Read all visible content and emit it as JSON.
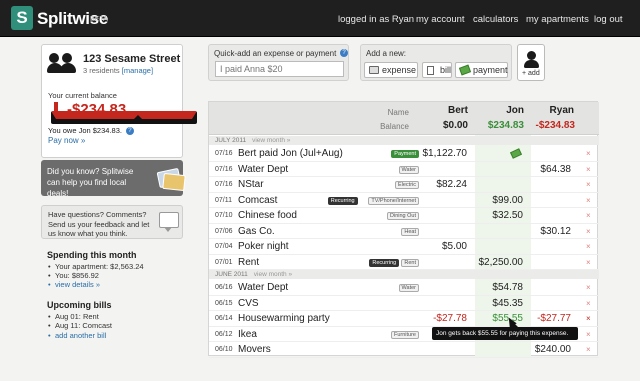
{
  "app": {
    "name": "Splitwise",
    "beta": "BETA",
    "logo_letter": "S"
  },
  "nav": [
    "logged in as Ryan",
    "my account",
    "calculators",
    "my apartments",
    "log out"
  ],
  "sidebar": {
    "address": "123 Sesame Street",
    "residents": "3 residents",
    "manage": "[manage]",
    "balance_label": "Your current balance",
    "balance": "-$234.83",
    "owe": "You owe Jon $234.83.",
    "pay_now": "Pay now »",
    "did_you_know": "Did you know? Splitwise can help you find local deals!",
    "questions": "Have questions? Comments? Send us your feedback and let us know what you think.",
    "spending_title": "Spending this month",
    "spending": [
      "Your apartment: $2,563.24",
      "You: $856.92"
    ],
    "view_details": "view details »",
    "bills_title": "Upcoming bills",
    "bills": [
      "Aug 01: Rent",
      "Aug 11: Comcast"
    ],
    "add_bill": "add another bill"
  },
  "quick_add": {
    "label": "Quick-add an expense or payment",
    "placeholder": "I paid Anna $20",
    "help": "?"
  },
  "add_new": {
    "label": "Add a new:",
    "buttons": [
      "expense",
      "bill",
      "payment"
    ]
  },
  "add_person": {
    "label": "+ add"
  },
  "table": {
    "name_label": "Name",
    "balance_label": "Balance",
    "people": [
      {
        "name": "Bert",
        "balance": "$0.00"
      },
      {
        "name": "Jon",
        "balance": "$234.83"
      },
      {
        "name": "Ryan",
        "balance": "-$234.83"
      }
    ],
    "months": [
      {
        "label": "JULY 2011",
        "view": "view month »",
        "rows": [
          {
            "date": "07/16",
            "desc": "Bert paid Jon (Jul+Aug)",
            "tags": [
              "Payment"
            ],
            "bert": "$1,122.70",
            "jon": "",
            "ryan": ""
          },
          {
            "date": "07/16",
            "desc": "Water Dept",
            "tags": [
              "Water"
            ],
            "bert": "",
            "jon": "",
            "ryan": "$64.38"
          },
          {
            "date": "07/16",
            "desc": "NStar",
            "tags": [
              "Electric"
            ],
            "bert": "$82.24",
            "jon": "",
            "ryan": ""
          },
          {
            "date": "07/11",
            "desc": "Comcast",
            "tags": [
              "Recurring",
              "TV/Phone/Internet"
            ],
            "bert": "",
            "jon": "$99.00",
            "ryan": ""
          },
          {
            "date": "07/10",
            "desc": "Chinese food",
            "tags": [
              "Dining Out"
            ],
            "bert": "",
            "jon": "$32.50",
            "ryan": ""
          },
          {
            "date": "07/06",
            "desc": "Gas Co.",
            "tags": [
              "Heat"
            ],
            "bert": "",
            "jon": "",
            "ryan": "$30.12"
          },
          {
            "date": "07/04",
            "desc": "Poker night",
            "tags": [],
            "bert": "$5.00",
            "jon": "",
            "ryan": ""
          },
          {
            "date": "07/01",
            "desc": "Rent",
            "tags": [
              "Recurring",
              "Rent"
            ],
            "bert": "",
            "jon": "$2,250.00",
            "ryan": ""
          }
        ]
      },
      {
        "label": "JUNE 2011",
        "view": "view month »",
        "rows": [
          {
            "date": "06/16",
            "desc": "Water Dept",
            "tags": [
              "Water"
            ],
            "bert": "",
            "jon": "$54.78",
            "ryan": ""
          },
          {
            "date": "06/15",
            "desc": "CVS",
            "tags": [],
            "bert": "",
            "jon": "$45.35",
            "ryan": ""
          },
          {
            "date": "06/14",
            "desc": "Housewarming party",
            "tags": [],
            "bert": "-$27.78",
            "jon": "$55.55",
            "ryan": "-$27.77"
          },
          {
            "date": "06/12",
            "desc": "Ikea",
            "tags": [
              "Furniture"
            ],
            "bert": "",
            "jon": "",
            "ryan": ""
          },
          {
            "date": "06/10",
            "desc": "Movers",
            "tags": [],
            "bert": "",
            "jon": "",
            "ryan": "$240.00"
          }
        ]
      }
    ],
    "tooltip": "Jon gets back $55.55 for paying this expense.",
    "delete_icon": "×"
  }
}
